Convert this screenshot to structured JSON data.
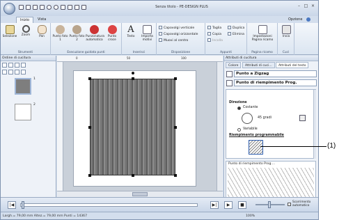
{
  "titlebar": {
    "title": "Senza titolo - PE-DESIGN PLUS"
  },
  "tabs": [
    {
      "label": "Inizio"
    },
    {
      "label": "Vista"
    }
  ],
  "options_label": "Opzione",
  "ribbon": {
    "strumenti": {
      "label": "Strumenti",
      "buttons": [
        "Selezione",
        "Zoom",
        "Pan"
      ]
    },
    "guidata": {
      "label": "Esecuzione guidata punti",
      "buttons": [
        "Punto foto 1",
        "Punto foto 2",
        "Punzonatura automatica",
        "Punto croce"
      ]
    },
    "inserisci": {
      "label": "Inserisci",
      "buttons": [
        "Testo",
        "Importa motivi"
      ]
    },
    "disposizione": {
      "label": "Disposizione",
      "items": [
        "Capovolgi verticale",
        "Capovolgi orizzontale",
        "Muovi al centro"
      ]
    },
    "appunti": {
      "label": "Appunti",
      "items": [
        "Taglia",
        "Duplica",
        "Copia",
        "Elimina",
        "Incolla"
      ]
    },
    "pagina": {
      "label": "Pagina ricamo",
      "buttons": [
        "Impostazioni Pagina ricamo"
      ]
    },
    "cucì": {
      "label": "Cucì",
      "buttons": [
        "Invia"
      ]
    }
  },
  "left_panel": {
    "title": "Ordine di cucitura",
    "items": [
      "1",
      "2"
    ]
  },
  "ruler": {
    "ticks": [
      "0",
      "50",
      "100"
    ]
  },
  "right_panel": {
    "title": "Attributi di cucitura",
    "tabs": [
      "Colore",
      "Attributi di cuci...",
      "Attributi del testo"
    ],
    "line_sew": "Punto a Zigzag",
    "region_sew": "Punto di riempimento Prog.",
    "direction_label": "Direzione",
    "constant": "Costante",
    "degrees": "45 gradi",
    "variable": "Variabile",
    "programmable": "Riempimento programmabile",
    "pattern_name": "Punto di riempimento Prog...."
  },
  "playbar": {
    "auto_scroll": "Scorrimento automatico"
  },
  "statusbar": {
    "text": "Largh.= 79,00 mm Altez.= 79,00 mm Punti = 14367",
    "zoom": "100%"
  },
  "callout": {
    "label": "(1)"
  }
}
